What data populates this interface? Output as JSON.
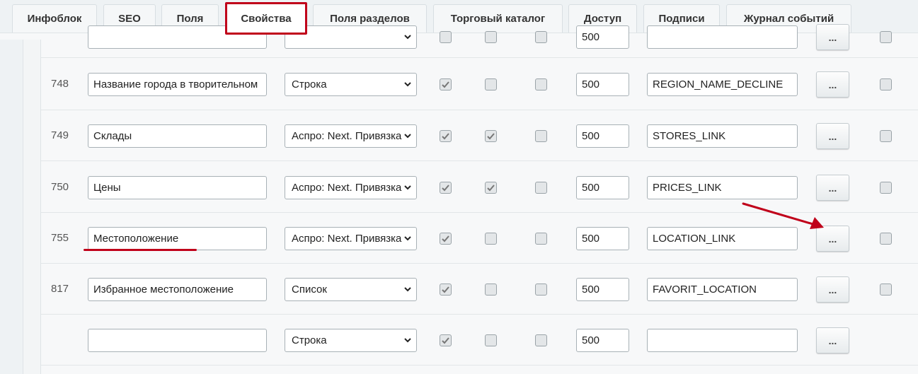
{
  "tabs": [
    {
      "label": "Инфоблок"
    },
    {
      "label": "SEO"
    },
    {
      "label": "Поля"
    },
    {
      "label": "Свойства"
    },
    {
      "label": "Поля разделов"
    },
    {
      "label": "Торговый каталог"
    },
    {
      "label": "Доступ"
    },
    {
      "label": "Подписи"
    },
    {
      "label": "Журнал событий"
    }
  ],
  "active_tab": "Свойства",
  "rows": [
    {
      "id": "",
      "name": "",
      "type": "",
      "c1": false,
      "c2": false,
      "c3": false,
      "sort": "500",
      "code": "",
      "btn": "...",
      "del": false
    },
    {
      "id": "748",
      "name": "Название города в творительном",
      "type": "Строка",
      "c1": true,
      "c2": false,
      "c3": false,
      "sort": "500",
      "code": "REGION_NAME_DECLINE",
      "btn": "...",
      "del": false
    },
    {
      "id": "749",
      "name": "Склады",
      "type": "Аспро: Next. Привязка",
      "c1": true,
      "c2": true,
      "c3": false,
      "sort": "500",
      "code": "STORES_LINK",
      "btn": "...",
      "del": false
    },
    {
      "id": "750",
      "name": "Цены",
      "type": "Аспро: Next. Привязка",
      "c1": true,
      "c2": true,
      "c3": false,
      "sort": "500",
      "code": "PRICES_LINK",
      "btn": "...",
      "del": false
    },
    {
      "id": "755",
      "name": "Местоположение",
      "type": "Аспро: Next. Привязка",
      "c1": true,
      "c2": false,
      "c3": false,
      "sort": "500",
      "code": "LOCATION_LINK",
      "btn": "...",
      "del": false
    },
    {
      "id": "817",
      "name": "Избранное местоположение",
      "type": "Список",
      "c1": true,
      "c2": false,
      "c3": false,
      "sort": "500",
      "code": "FAVORIT_LOCATION",
      "btn": "...",
      "del": false
    },
    {
      "id": "",
      "name": "",
      "type": "Строка",
      "c1": true,
      "c2": false,
      "c3": false,
      "sort": "500",
      "code": "",
      "btn": "...",
      "del": null
    }
  ],
  "colors": {
    "accent": "#c0001a",
    "check": "#777777"
  },
  "icons": {
    "select": "chevron-down-icon",
    "checkbox": "checkmark-icon",
    "annotation": "red-arrow-icon"
  }
}
